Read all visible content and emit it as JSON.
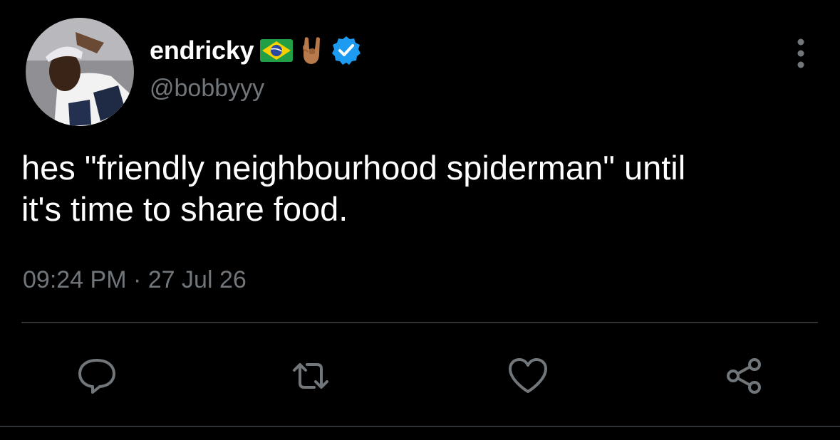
{
  "author": {
    "display_name": "endricky",
    "handle": "@bobbyyy",
    "verified": true,
    "badges": [
      "brazil-flag-icon",
      "rock-hand-icon",
      "verified-icon"
    ]
  },
  "tweet": {
    "text": "hes \"friendly neighbourhood spiderman\" until\nit's time to share food.",
    "time": "09:24 PM",
    "separator": "·",
    "date": "27 Jul 26"
  },
  "actions": [
    "reply-icon",
    "retweet-icon",
    "like-icon",
    "share-icon"
  ],
  "colors": {
    "background": "#000000",
    "text": "#ffffff",
    "secondary_text": "#71767b",
    "divider": "#2f3336",
    "verified": "#1d9bf0"
  }
}
